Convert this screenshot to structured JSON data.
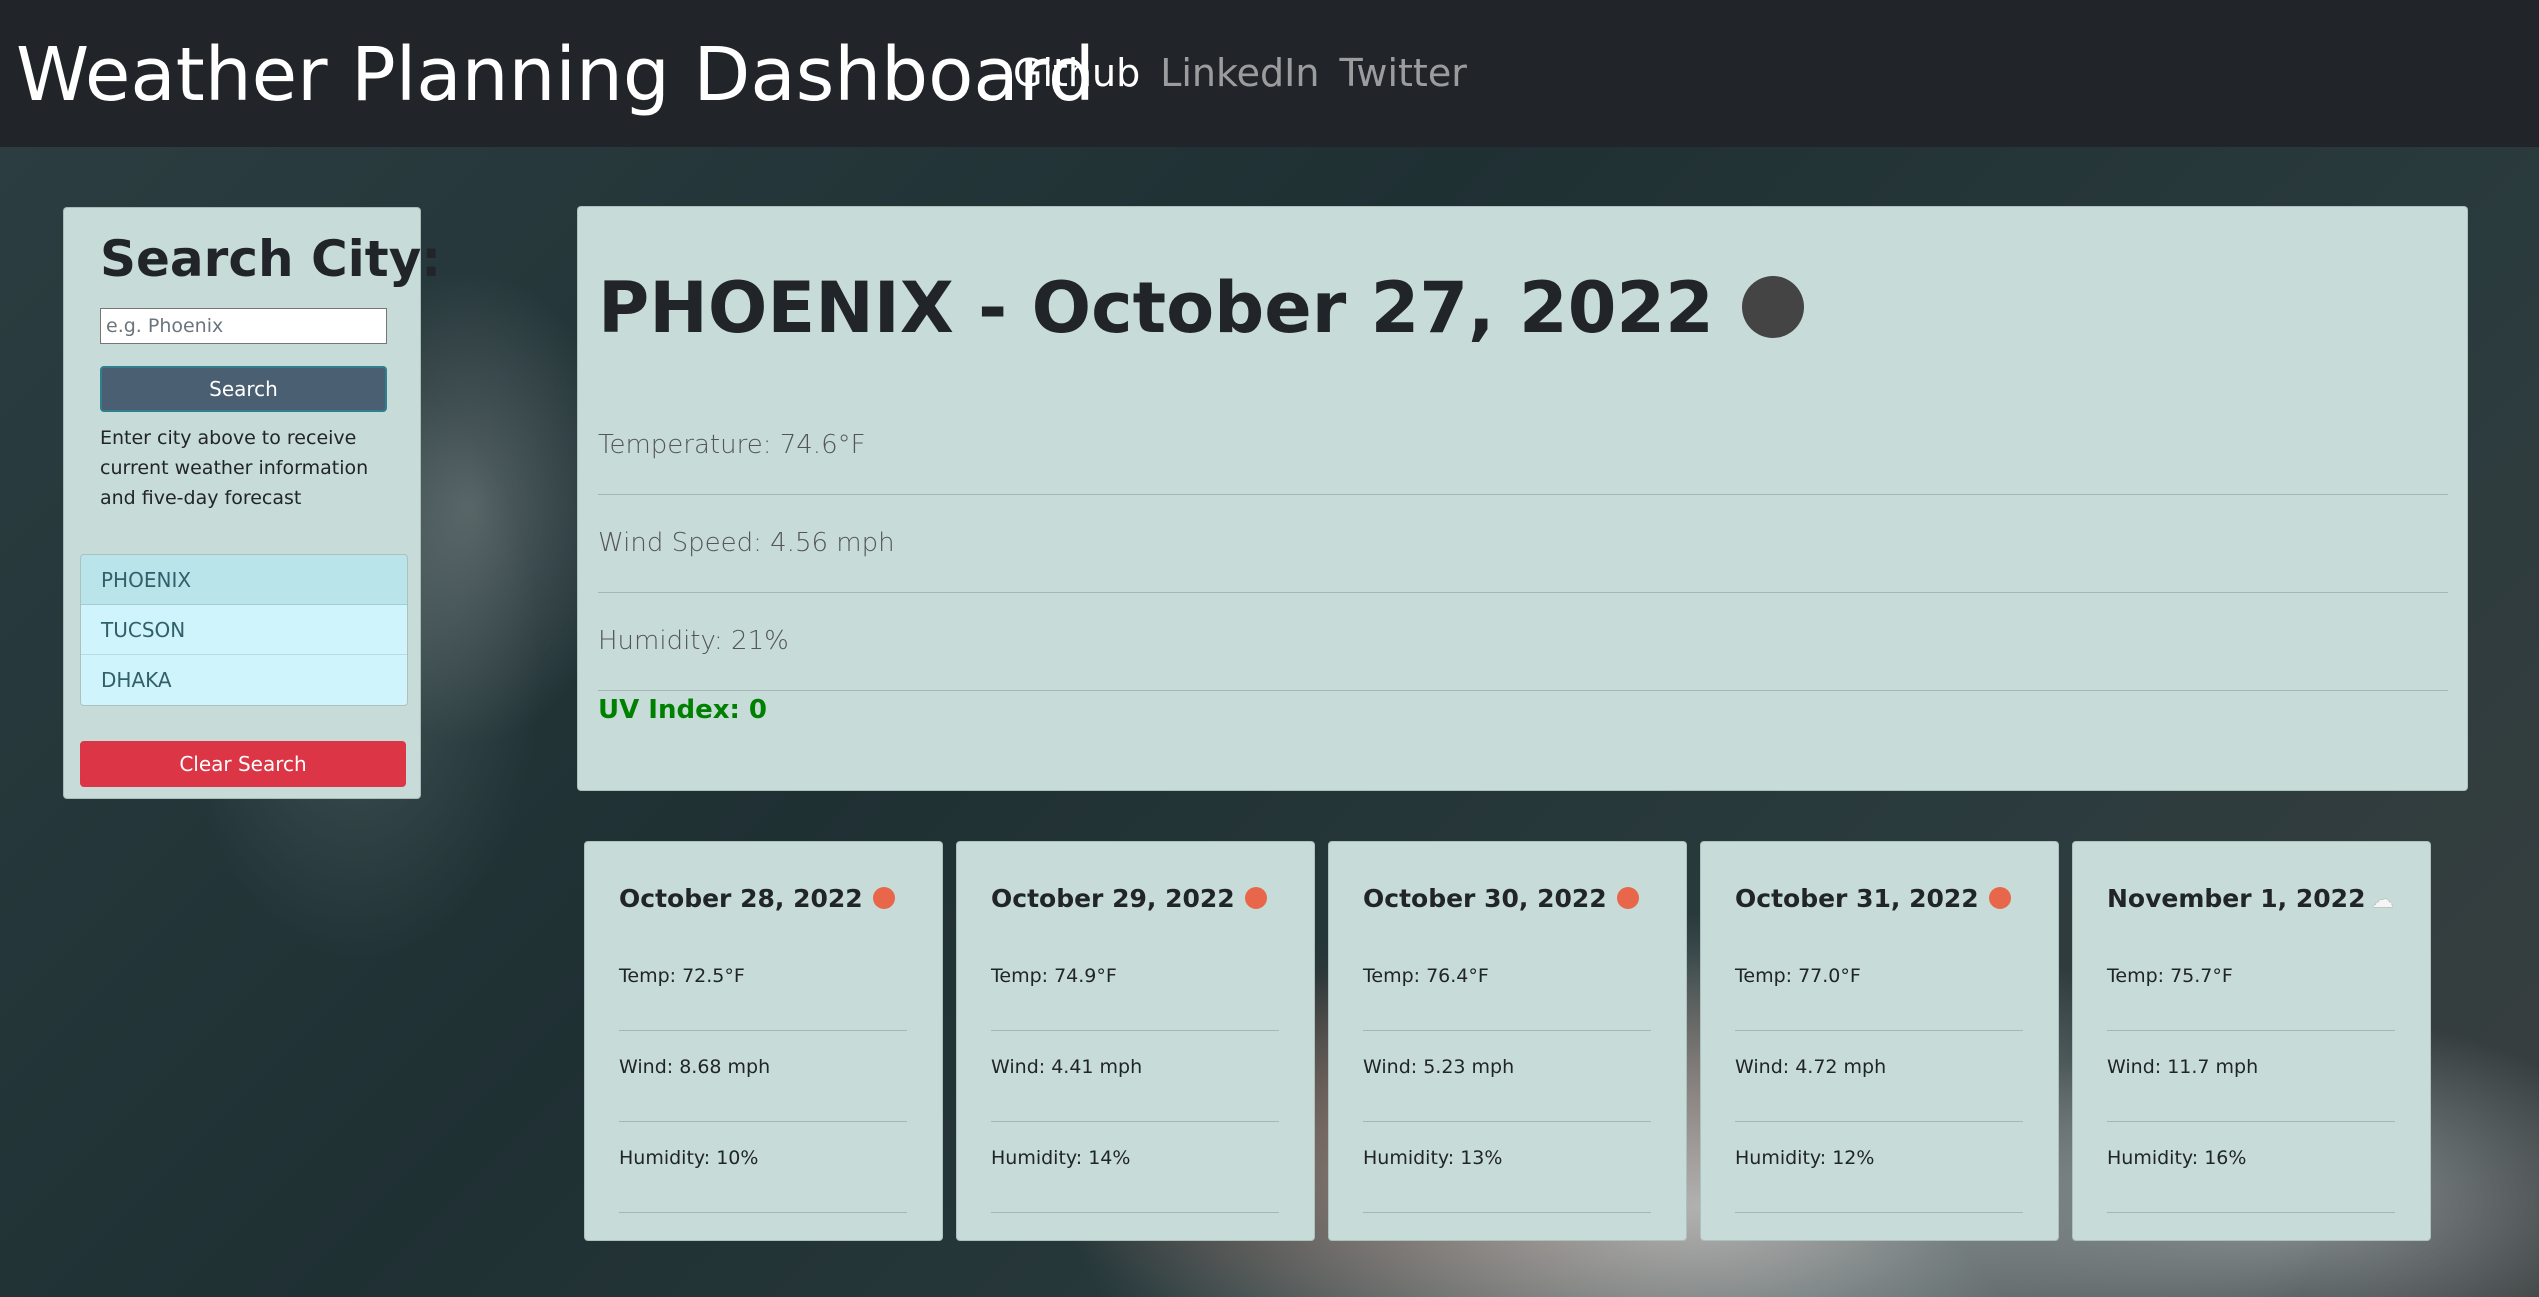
{
  "navbar": {
    "brand": "Weather Planning Dashboard",
    "links": [
      "Github",
      "LinkedIn",
      "Twitter"
    ]
  },
  "search": {
    "title": "Search City:",
    "placeholder": "e.g. Phoenix",
    "button_label": "Search",
    "hint": "Enter city above to receive current weather information and five-day forecast",
    "history": [
      "PHOENIX",
      "TUCSON",
      "DHAKA"
    ],
    "clear_label": "Clear Search"
  },
  "current": {
    "title": "PHOENIX - October 27, 2022",
    "icon": "dark-circle-icon",
    "temperature": "Temperature: 74.6°F",
    "wind": "Wind Speed: 4.56 mph",
    "humidity": "Humidity: 21%",
    "uv": "UV Index: 0",
    "uv_color": "#008000"
  },
  "forecast": [
    {
      "date": "October 28, 2022",
      "icon": "sun-icon",
      "temp": "Temp: 72.5°F",
      "wind": "Wind: 8.68 mph",
      "humidity": "Humidity: 10%"
    },
    {
      "date": "October 29, 2022",
      "icon": "sun-icon",
      "temp": "Temp: 74.9°F",
      "wind": "Wind: 4.41 mph",
      "humidity": "Humidity: 14%"
    },
    {
      "date": "October 30, 2022",
      "icon": "sun-icon",
      "temp": "Temp: 76.4°F",
      "wind": "Wind: 5.23 mph",
      "humidity": "Humidity: 13%"
    },
    {
      "date": "October 31, 2022",
      "icon": "sun-icon",
      "temp": "Temp: 77.0°F",
      "wind": "Wind: 4.72 mph",
      "humidity": "Humidity: 12%"
    },
    {
      "date": "November 1, 2022",
      "icon": "cloud-icon",
      "temp": "Temp: 75.7°F",
      "wind": "Wind: 11.7 mph",
      "humidity": "Humidity: 16%"
    }
  ],
  "colors": {
    "navbar": "#212529",
    "card": "#c7dbd8",
    "search_button": "#4a5f72",
    "clear_button": "#dc3545",
    "sun_icon": "#e8674a"
  }
}
